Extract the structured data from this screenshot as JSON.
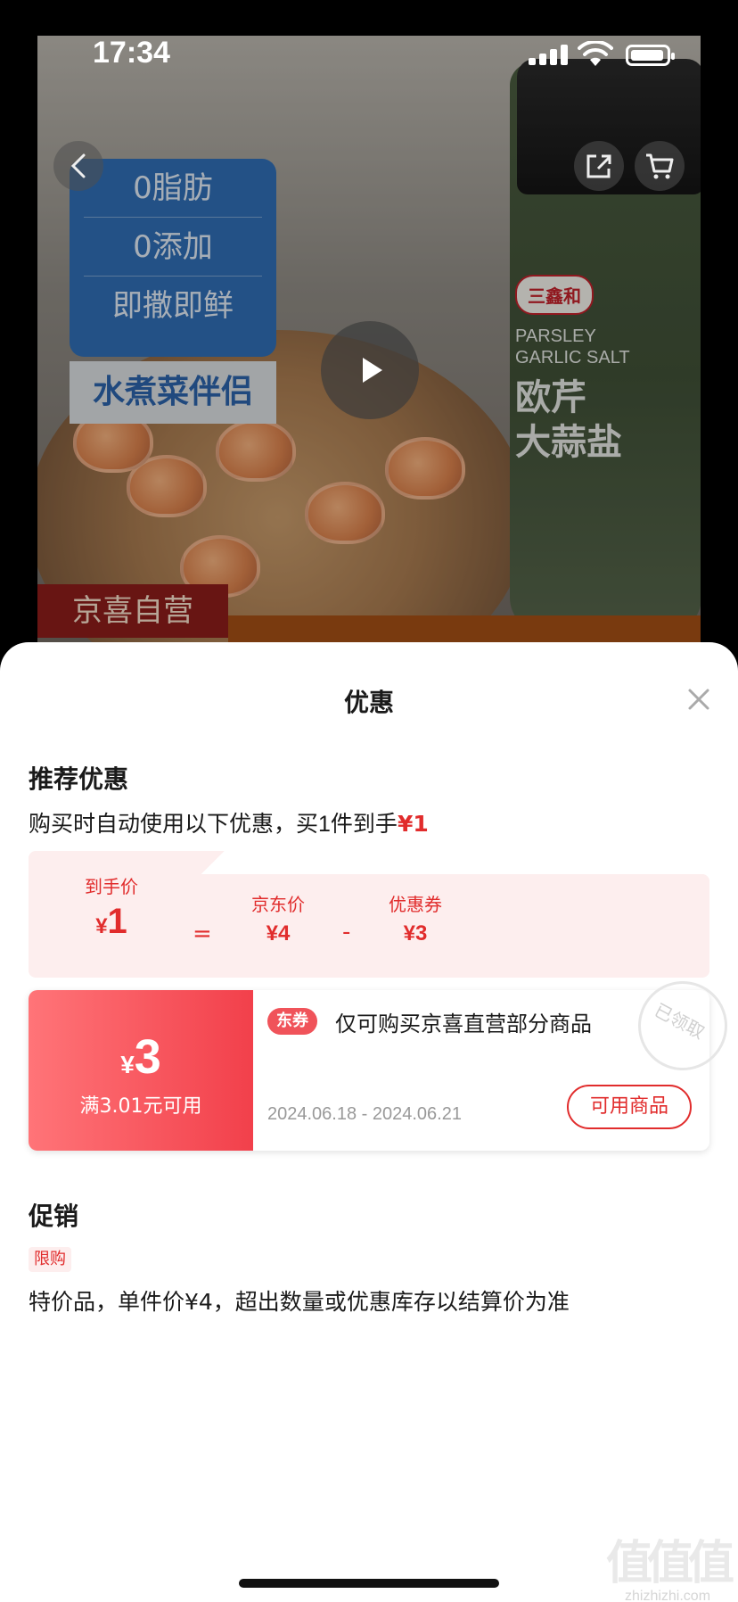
{
  "status_bar": {
    "time": "17:34"
  },
  "product_image": {
    "badge_lines": [
      "0脂肪",
      "0添加",
      "即撒即鲜"
    ],
    "badge_sub": "水煮菜伴侣",
    "bottle_brand": "三鑫和",
    "bottle_en": "PARSLEY GARLIC SALT",
    "bottle_cn_1": "欧芹",
    "bottle_cn_2": "大蒜盐",
    "self_tag": "京喜自营"
  },
  "sheet": {
    "title": "优惠",
    "recommend": {
      "title": "推荐优惠",
      "desc_prefix": "购买时自动使用以下优惠，买",
      "qty": "1",
      "desc_mid": "件到手",
      "final_price": "¥1"
    },
    "calc": {
      "final_label": "到手价",
      "final_cur": "¥",
      "final_value": "1",
      "eq": "=",
      "jd_label": "京东价",
      "jd_value": "¥4",
      "minus": "-",
      "coupon_label": "优惠券",
      "coupon_value": "¥3"
    },
    "coupon": {
      "currency": "¥",
      "amount": "3",
      "condition": "满3.01元可用",
      "badge": "东券",
      "text": "仅可购买京喜直营部分商品",
      "date_range": "2024.06.18 - 2024.06.21",
      "button": "可用商品",
      "stamp": "已领取"
    },
    "promotion": {
      "title": "促销",
      "tag": "限购",
      "desc": "特价品，单件价¥4，超出数量或优惠库存以结算价为准"
    }
  },
  "watermark": {
    "big": "值值值",
    "small": "zhizhizhi.com"
  },
  "colors": {
    "accent": "#e12c2c",
    "coupon_gradient_start": "#ff7478",
    "coupon_gradient_end": "#f2404b"
  }
}
